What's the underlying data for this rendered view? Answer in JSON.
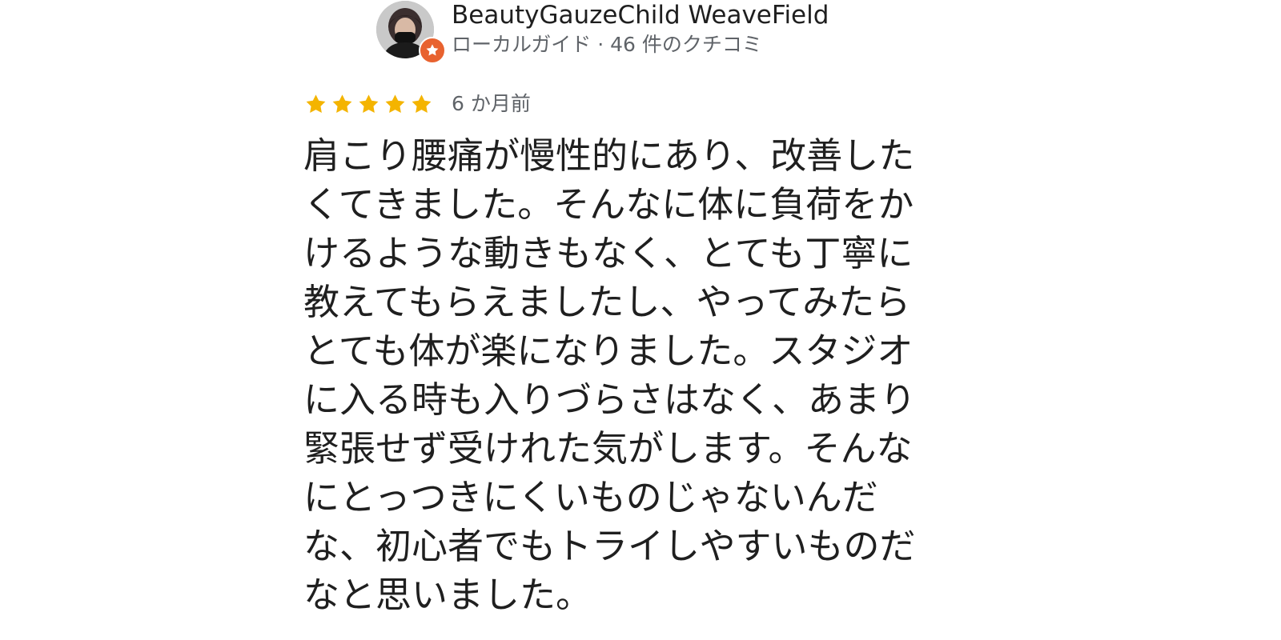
{
  "reviewer": {
    "name": "BeautyGauzeChild WeaveField",
    "meta": "ローカルガイド · 46 件のクチコミ",
    "avatar_icon": "user-avatar",
    "badge_icon": "local-guide-star-icon"
  },
  "rating": {
    "stars": 5,
    "max_stars": 5,
    "star_color": "#f4b400",
    "time_ago": "6 か月前"
  },
  "review": {
    "lines": [
      "肩こり腰痛が慢性的にあり、改善した",
      "くてきました。そんなに体に負荷をか",
      "けるような動きもなく、とても丁寧に",
      "教えてもらえましたし、やってみたら",
      "とても体が楽になりました。スタジオ",
      "に入る時も入りづらさはなく、あまり",
      "緊張せず受けれた気がします。そんな",
      "にとっつきにくいものじゃないんだ",
      "な、初心者でもトライしやすいものだ",
      "なと思いました。"
    ]
  },
  "colors": {
    "badge": "#e8622f",
    "text_primary": "#1f1f1f",
    "text_secondary": "#5f6368"
  }
}
